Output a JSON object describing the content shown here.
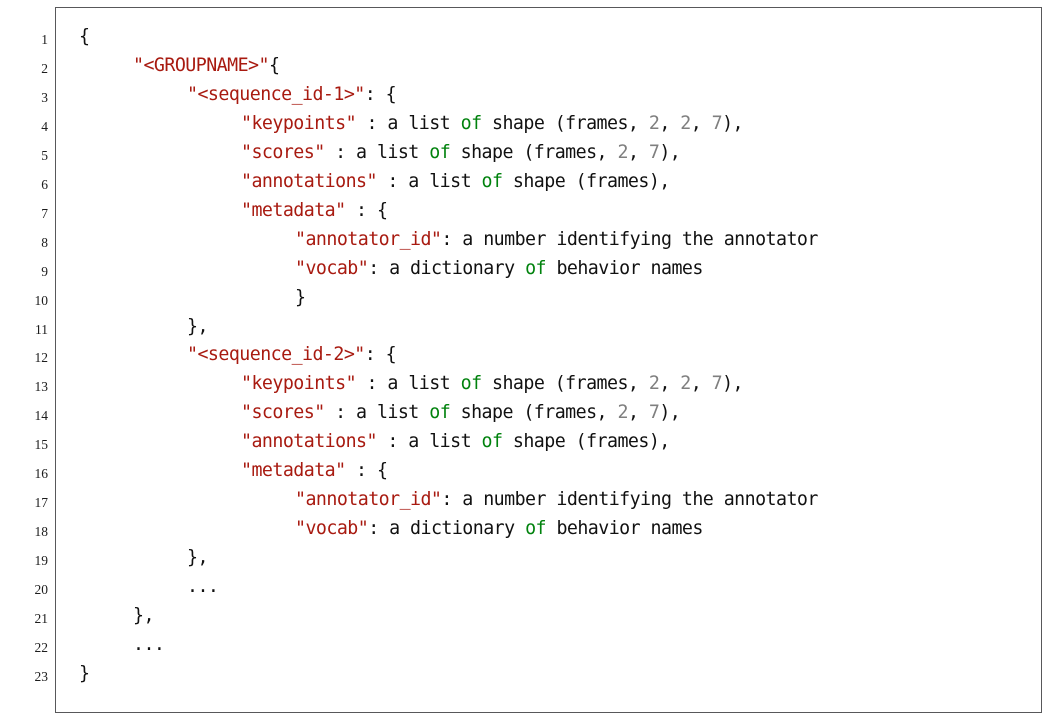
{
  "figure": {
    "kind": "code-listing",
    "language": "json",
    "frame": true,
    "line_numbers_shown": true,
    "colors": {
      "string": "#a81a10",
      "keyword": "#00820d",
      "number": "#7f7f7f",
      "plain": "#111111",
      "frame_border": "#58585a",
      "background": "#ffffff",
      "line_number": "#1c1c1c"
    }
  },
  "code": {
    "line_numbers": [
      "1",
      "2",
      "3",
      "4",
      "5",
      "6",
      "7",
      "8",
      "9",
      "10",
      "11",
      "12",
      "13",
      "14",
      "15",
      "16",
      "17",
      "18",
      "19",
      "20",
      "21",
      "22",
      "23"
    ],
    "lines": [
      {
        "n": "1",
        "indent": 0,
        "tokens": [
          {
            "t": "{",
            "c": "plain"
          }
        ]
      },
      {
        "n": "2",
        "indent": 4,
        "tokens": [
          {
            "t": "\"<GROUPNAME>\"",
            "c": "string"
          },
          {
            "t": "{",
            "c": "plain"
          }
        ]
      },
      {
        "n": "3",
        "indent": 8,
        "tokens": [
          {
            "t": "\"<sequence_id-1>\"",
            "c": "string"
          },
          {
            "t": ": {",
            "c": "plain"
          }
        ]
      },
      {
        "n": "4",
        "indent": 12,
        "tokens": [
          {
            "t": "\"keypoints\"",
            "c": "string"
          },
          {
            "t": " : a list ",
            "c": "plain"
          },
          {
            "t": "of",
            "c": "keyword"
          },
          {
            "t": " shape (frames, ",
            "c": "plain"
          },
          {
            "t": "2",
            "c": "number"
          },
          {
            "t": ", ",
            "c": "plain"
          },
          {
            "t": "2",
            "c": "number"
          },
          {
            "t": ", ",
            "c": "plain"
          },
          {
            "t": "7",
            "c": "number"
          },
          {
            "t": "),",
            "c": "plain"
          }
        ]
      },
      {
        "n": "5",
        "indent": 12,
        "tokens": [
          {
            "t": "\"scores\"",
            "c": "string"
          },
          {
            "t": " : a list ",
            "c": "plain"
          },
          {
            "t": "of",
            "c": "keyword"
          },
          {
            "t": " shape (frames, ",
            "c": "plain"
          },
          {
            "t": "2",
            "c": "number"
          },
          {
            "t": ", ",
            "c": "plain"
          },
          {
            "t": "7",
            "c": "number"
          },
          {
            "t": "),",
            "c": "plain"
          }
        ]
      },
      {
        "n": "6",
        "indent": 12,
        "tokens": [
          {
            "t": "\"annotations\"",
            "c": "string"
          },
          {
            "t": " : a list ",
            "c": "plain"
          },
          {
            "t": "of",
            "c": "keyword"
          },
          {
            "t": " shape (frames),",
            "c": "plain"
          }
        ]
      },
      {
        "n": "7",
        "indent": 12,
        "tokens": [
          {
            "t": "\"metadata\"",
            "c": "string"
          },
          {
            "t": " : {",
            "c": "plain"
          }
        ]
      },
      {
        "n": "8",
        "indent": 16,
        "tokens": [
          {
            "t": "\"annotator_id\"",
            "c": "string"
          },
          {
            "t": ": a number identifying the annotator",
            "c": "plain"
          }
        ]
      },
      {
        "n": "9",
        "indent": 16,
        "tokens": [
          {
            "t": "\"vocab\"",
            "c": "string"
          },
          {
            "t": ": a dictionary ",
            "c": "plain"
          },
          {
            "t": "of",
            "c": "keyword"
          },
          {
            "t": " behavior names",
            "c": "plain"
          }
        ]
      },
      {
        "n": "10",
        "indent": 16,
        "tokens": [
          {
            "t": "}",
            "c": "plain"
          }
        ]
      },
      {
        "n": "11",
        "indent": 8,
        "tokens": [
          {
            "t": "},",
            "c": "plain"
          }
        ]
      },
      {
        "n": "12",
        "indent": 8,
        "tokens": [
          {
            "t": "\"<sequence_id-2>\"",
            "c": "string"
          },
          {
            "t": ": {",
            "c": "plain"
          }
        ]
      },
      {
        "n": "13",
        "indent": 12,
        "tokens": [
          {
            "t": "\"keypoints\"",
            "c": "string"
          },
          {
            "t": " : a list ",
            "c": "plain"
          },
          {
            "t": "of",
            "c": "keyword"
          },
          {
            "t": " shape (frames, ",
            "c": "plain"
          },
          {
            "t": "2",
            "c": "number"
          },
          {
            "t": ", ",
            "c": "plain"
          },
          {
            "t": "2",
            "c": "number"
          },
          {
            "t": ", ",
            "c": "plain"
          },
          {
            "t": "7",
            "c": "number"
          },
          {
            "t": "),",
            "c": "plain"
          }
        ]
      },
      {
        "n": "14",
        "indent": 12,
        "tokens": [
          {
            "t": "\"scores\"",
            "c": "string"
          },
          {
            "t": " : a list ",
            "c": "plain"
          },
          {
            "t": "of",
            "c": "keyword"
          },
          {
            "t": " shape (frames, ",
            "c": "plain"
          },
          {
            "t": "2",
            "c": "number"
          },
          {
            "t": ", ",
            "c": "plain"
          },
          {
            "t": "7",
            "c": "number"
          },
          {
            "t": "),",
            "c": "plain"
          }
        ]
      },
      {
        "n": "15",
        "indent": 12,
        "tokens": [
          {
            "t": "\"annotations\"",
            "c": "string"
          },
          {
            "t": " : a list ",
            "c": "plain"
          },
          {
            "t": "of",
            "c": "keyword"
          },
          {
            "t": " shape (frames),",
            "c": "plain"
          }
        ]
      },
      {
        "n": "16",
        "indent": 12,
        "tokens": [
          {
            "t": "\"metadata\"",
            "c": "string"
          },
          {
            "t": " : {",
            "c": "plain"
          }
        ]
      },
      {
        "n": "17",
        "indent": 16,
        "tokens": [
          {
            "t": "\"annotator_id\"",
            "c": "string"
          },
          {
            "t": ": a number identifying the annotator",
            "c": "plain"
          }
        ]
      },
      {
        "n": "18",
        "indent": 16,
        "tokens": [
          {
            "t": "\"vocab\"",
            "c": "string"
          },
          {
            "t": ": a dictionary ",
            "c": "plain"
          },
          {
            "t": "of",
            "c": "keyword"
          },
          {
            "t": " behavior names",
            "c": "plain"
          }
        ]
      },
      {
        "n": "19",
        "indent": 8,
        "tokens": [
          {
            "t": "},",
            "c": "plain"
          }
        ]
      },
      {
        "n": "20",
        "indent": 8,
        "tokens": [
          {
            "t": "...",
            "c": "plain"
          }
        ]
      },
      {
        "n": "21",
        "indent": 4,
        "tokens": [
          {
            "t": "},",
            "c": "plain"
          }
        ]
      },
      {
        "n": "22",
        "indent": 4,
        "tokens": [
          {
            "t": "...",
            "c": "plain"
          }
        ]
      },
      {
        "n": "23",
        "indent": 0,
        "tokens": [
          {
            "t": "}",
            "c": "plain"
          }
        ]
      }
    ]
  }
}
